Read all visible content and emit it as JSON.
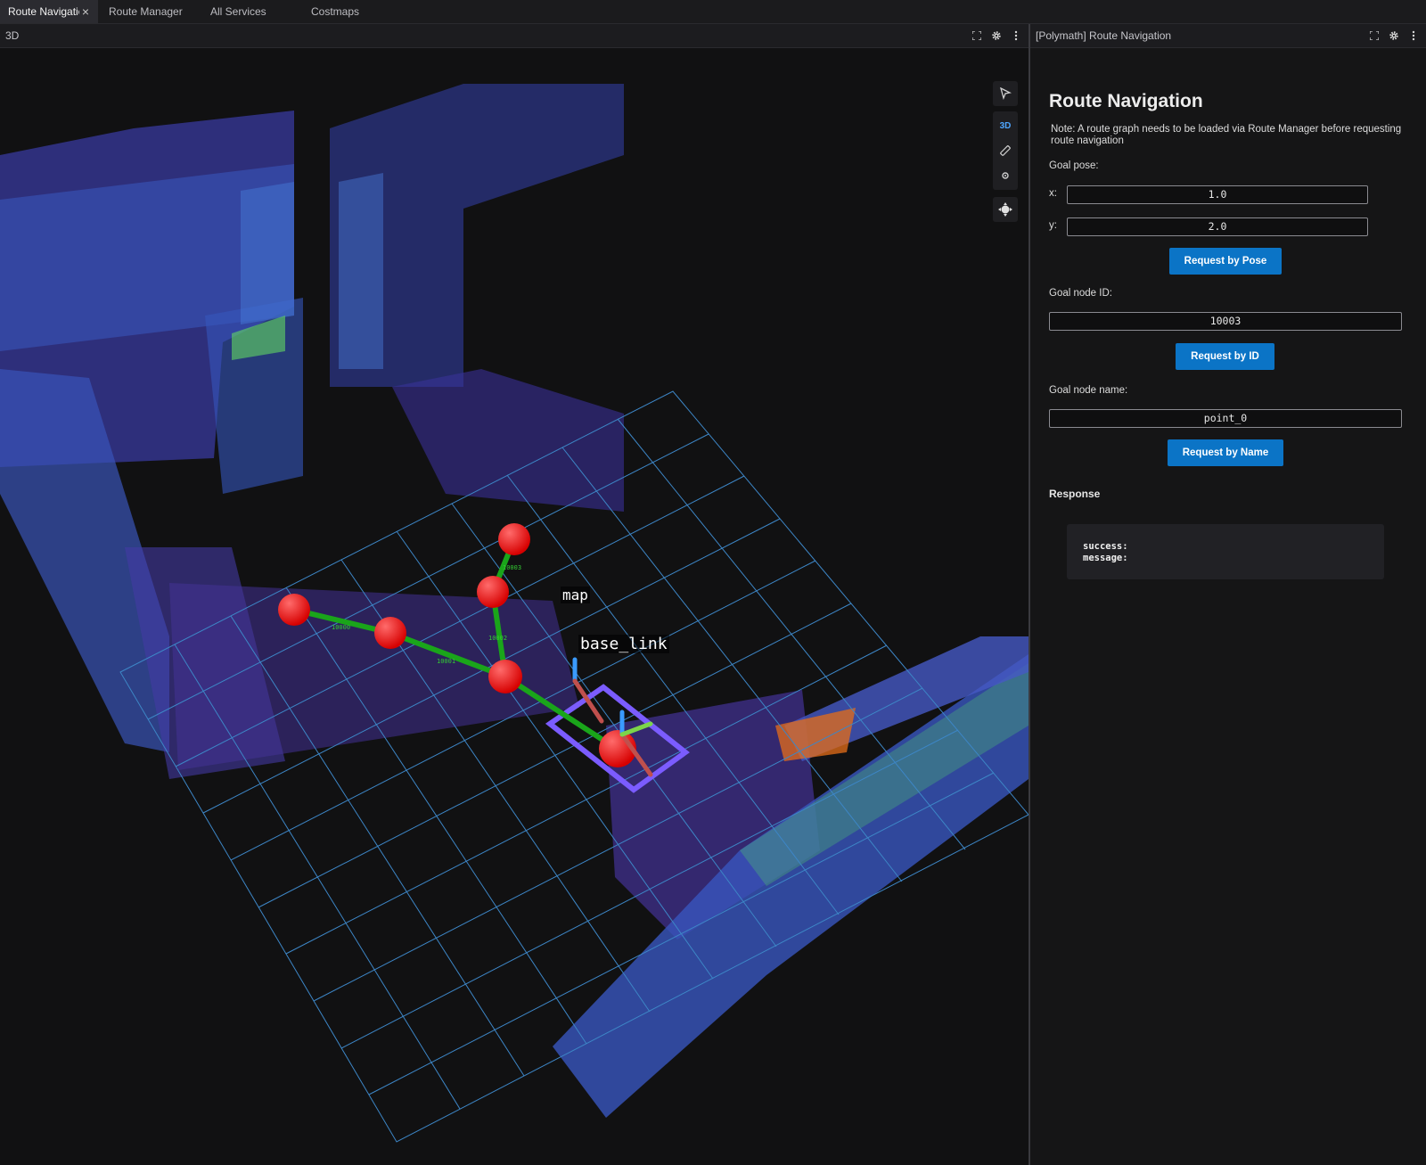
{
  "tabs": [
    {
      "label": "Route Navigation",
      "active": true,
      "closable": true
    },
    {
      "label": "Route Manager"
    },
    {
      "label": "All Services"
    },
    {
      "label": "Costmaps"
    }
  ],
  "viewport": {
    "panel_title": "3D",
    "header_icons": [
      "fullscreen-icon",
      "settings-icon",
      "more-icon"
    ],
    "tools": {
      "select": "cursor-icon",
      "mode_label": "3D",
      "measure": "ruler-icon",
      "publish": "publish-point-icon",
      "follow": "camera-follow-icon"
    },
    "frame_labels": {
      "map": "map",
      "base_link": "base_link"
    },
    "route_node_color": "#ff1a1a",
    "route_edge_color": "#1aa51a",
    "grid_color": "#3d86c6",
    "robot_footprint_color": "#7b5cff"
  },
  "route_panel": {
    "panel_title": "[Polymath] Route Navigation",
    "header_icons": [
      "fullscreen-icon",
      "settings-icon",
      "more-icon"
    ],
    "title": "Route Navigation",
    "note": "Note: A route graph needs to be loaded via Route Manager before requesting route navigation",
    "goal_pose_label": "Goal pose:",
    "x_label": "x:",
    "x_value": "1.0",
    "y_label": "y:",
    "y_value": "2.0",
    "request_by_pose": "Request by Pose",
    "goal_node_id_label": "Goal node ID:",
    "goal_node_id_value": "10003",
    "request_by_id": "Request by ID",
    "goal_node_name_label": "Goal node name:",
    "goal_node_name_value": "point_0",
    "request_by_name": "Request by Name",
    "response_title": "Response",
    "response_success": "success:",
    "response_message": "message:",
    "accent_color": "#0b74c6"
  }
}
